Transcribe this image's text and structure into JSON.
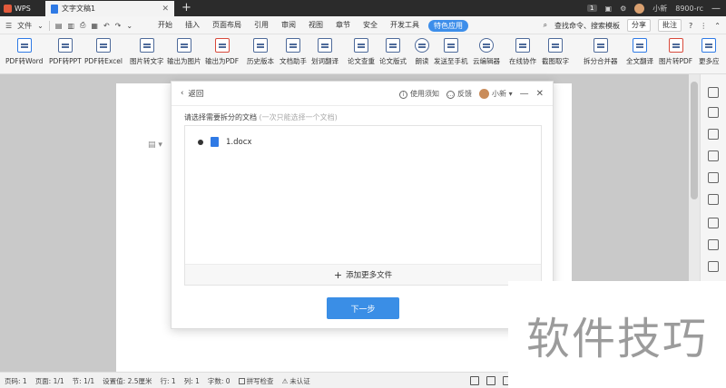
{
  "titlebar": {
    "app": "WPS",
    "tab_title": "文字文稿1",
    "close": "✕",
    "new_tab": "+",
    "badge": "1",
    "user_name": "小新",
    "user_status": "8900-rc"
  },
  "menubar": {
    "file": "文件",
    "tabs": [
      "开始",
      "插入",
      "页面布局",
      "引用",
      "审阅",
      "视图",
      "章节",
      "安全",
      "开发工具",
      "特色应用"
    ],
    "search": "查找命令、搜索模板",
    "share": "分享",
    "comment": "批注",
    "help": "?"
  },
  "toolbar": {
    "tools": [
      "PDF转Word",
      "PDF转PPT",
      "PDF转Excel",
      "图片转文字",
      "输出为图片",
      "输出为PDF",
      "历史版本",
      "文档助手",
      "划词翻译",
      "论文查重",
      "论文版式",
      "朗读",
      "发送至手机",
      "云编辑器",
      "在线协作",
      "截图取字",
      "拆分合并器",
      "全文翻译",
      "图片转PDF",
      "更多应"
    ]
  },
  "dialog": {
    "back": "返回",
    "help": "使用须知",
    "feedback": "反馈",
    "user": "小新",
    "subtitle": "请选择需要拆分的文档",
    "subtitle_hint": "(一次只能选择一个文档)",
    "file_name": "1.docx",
    "add_more": "添加更多文件",
    "next": "下一步"
  },
  "statusbar": {
    "page_num": "页码: 1",
    "pages": "页面: 1/1",
    "section": "节: 1/1",
    "setting": "设置值: 2.5厘米",
    "row": "行: 1",
    "col": "列: 1",
    "words": "字数: 0",
    "spell": "拼写检查",
    "auth": "未认证"
  },
  "watermark": "软件技巧",
  "colors": {
    "accent": "#3a8ee6",
    "titlebar": "#2b2b2b"
  }
}
